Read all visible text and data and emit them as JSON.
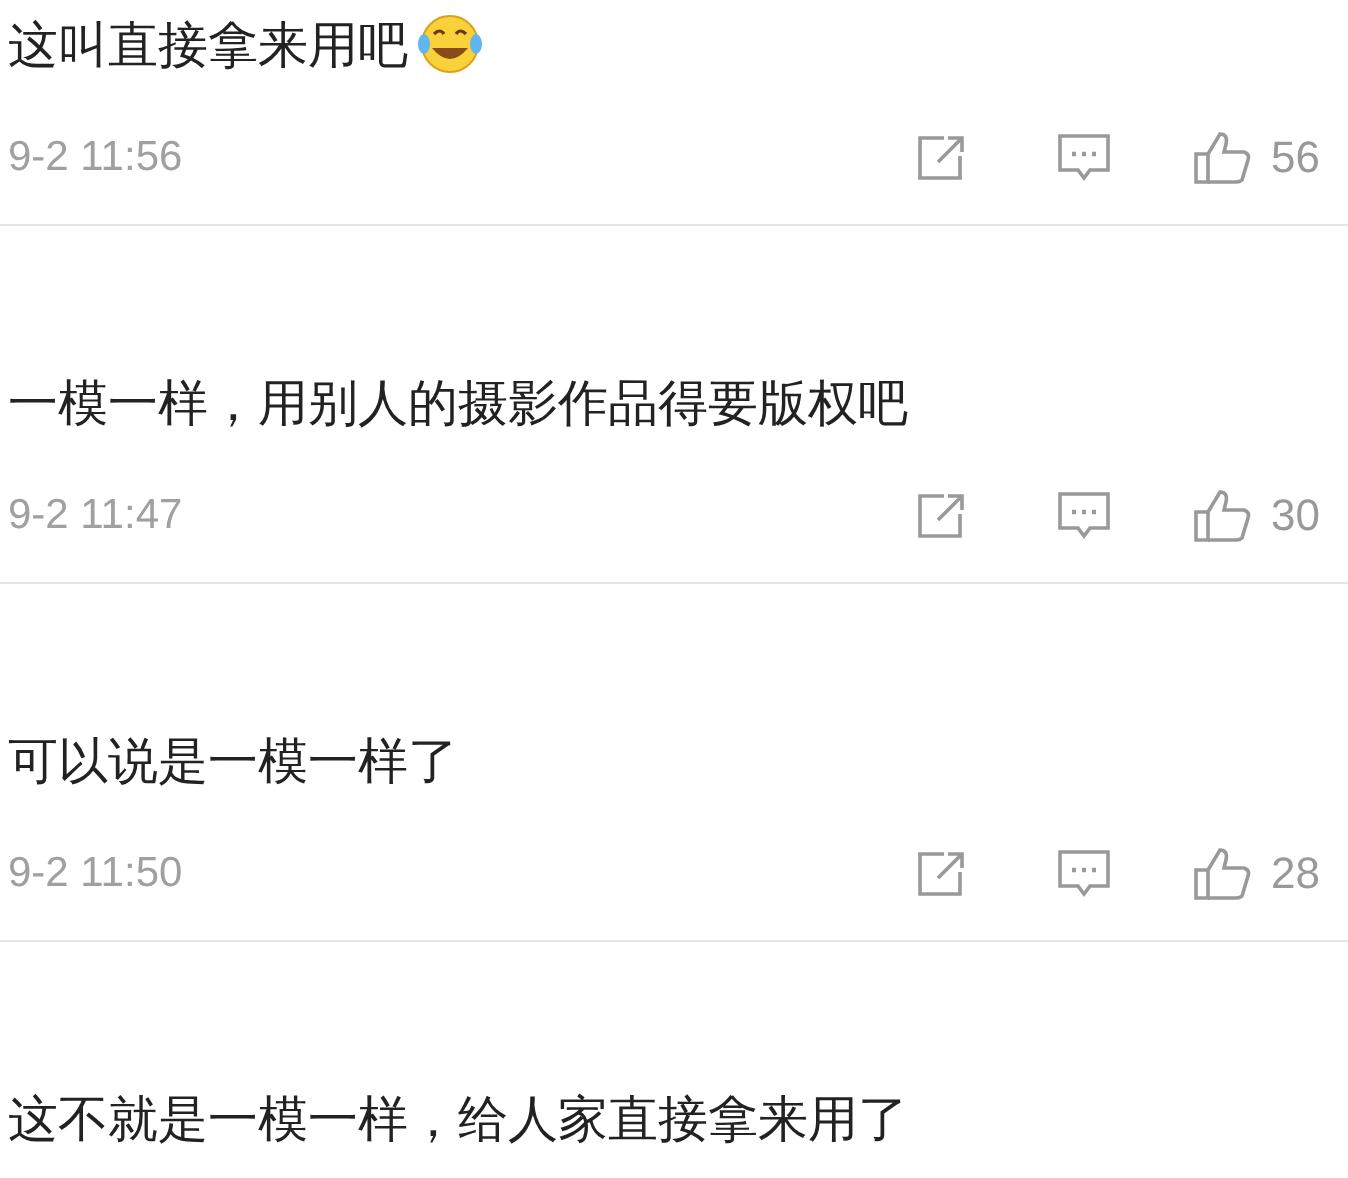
{
  "comments": [
    {
      "kind": "emoji",
      "text": "这叫直接拿来用吧",
      "time": "9-2 11:56",
      "likes": "56"
    },
    {
      "kind": "plain",
      "text": "一模一样，用别人的摄影作品得要版权吧",
      "time": "9-2 11:47",
      "likes": "30"
    },
    {
      "kind": "plain",
      "text": "可以说是一模一样了",
      "time": "9-2 11:50",
      "likes": "28"
    },
    {
      "kind": "plain",
      "text": "这不就是一模一样，给人家直接拿来用了"
    }
  ]
}
